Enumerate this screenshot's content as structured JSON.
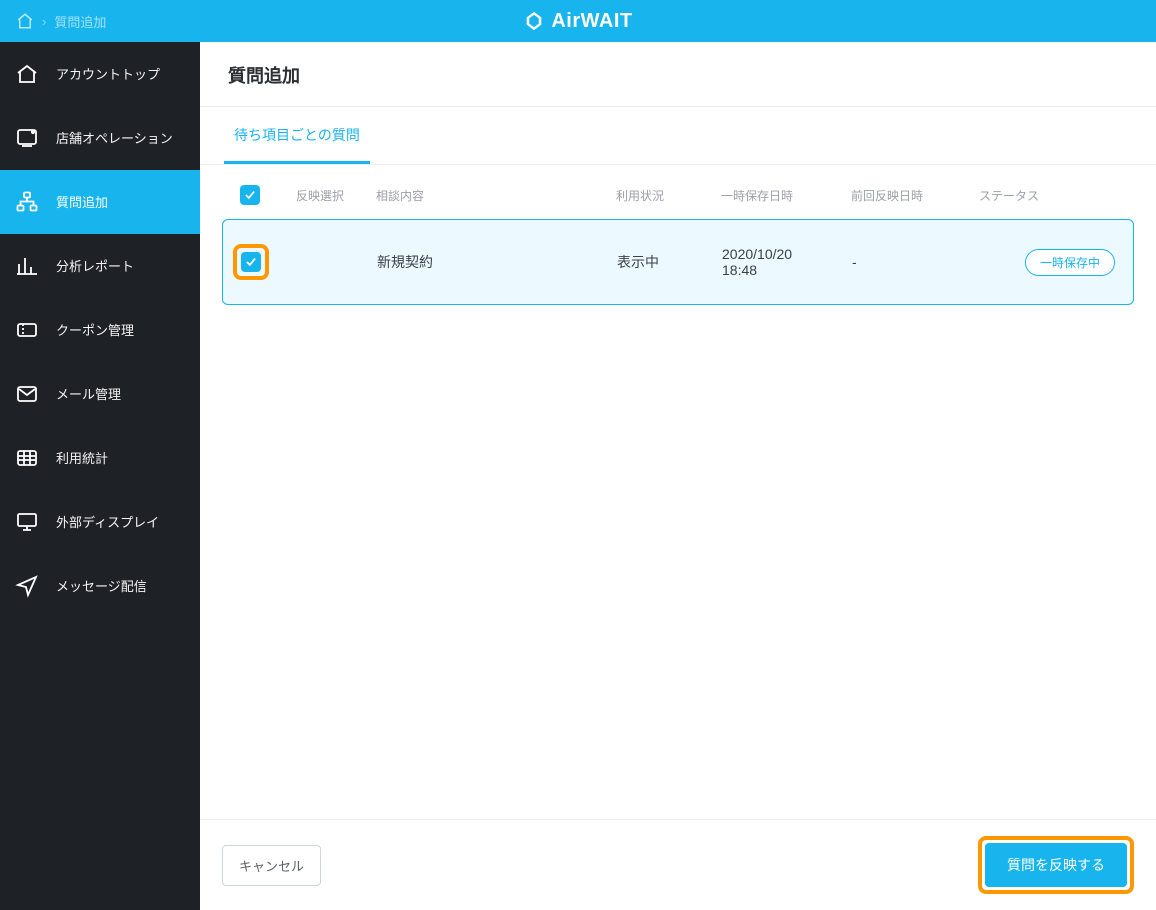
{
  "topbar": {
    "breadcrumb_current": "質問追加",
    "brand_name": "AirWAIT"
  },
  "sidebar": {
    "items": [
      {
        "label": "アカウントトップ",
        "icon": "home"
      },
      {
        "label": "店舗オペレーション",
        "icon": "store-ops"
      },
      {
        "label": "質問追加",
        "icon": "sitemap",
        "active": true
      },
      {
        "label": "分析レポート",
        "icon": "bar-chart"
      },
      {
        "label": "クーポン管理",
        "icon": "ticket"
      },
      {
        "label": "メール管理",
        "icon": "mail"
      },
      {
        "label": "利用統計",
        "icon": "grid"
      },
      {
        "label": "外部ディスプレイ",
        "icon": "monitor"
      },
      {
        "label": "メッセージ配信",
        "icon": "send"
      }
    ]
  },
  "page": {
    "title": "質問追加",
    "tab_label": "待ち項目ごとの質問"
  },
  "table": {
    "headers": {
      "select": "反映選択",
      "content": "相談内容",
      "usage": "利用状況",
      "saved_at": "一時保存日時",
      "prev_reflected_at": "前回反映日時",
      "status": "ステータス"
    },
    "rows": [
      {
        "checked": true,
        "content": "新規契約",
        "usage": "表示中",
        "saved_at": "2020/10/20 18:48",
        "prev_reflected_at": "-",
        "status": "一時保存中"
      }
    ]
  },
  "footer": {
    "cancel": "キャンセル",
    "submit": "質問を反映する"
  }
}
